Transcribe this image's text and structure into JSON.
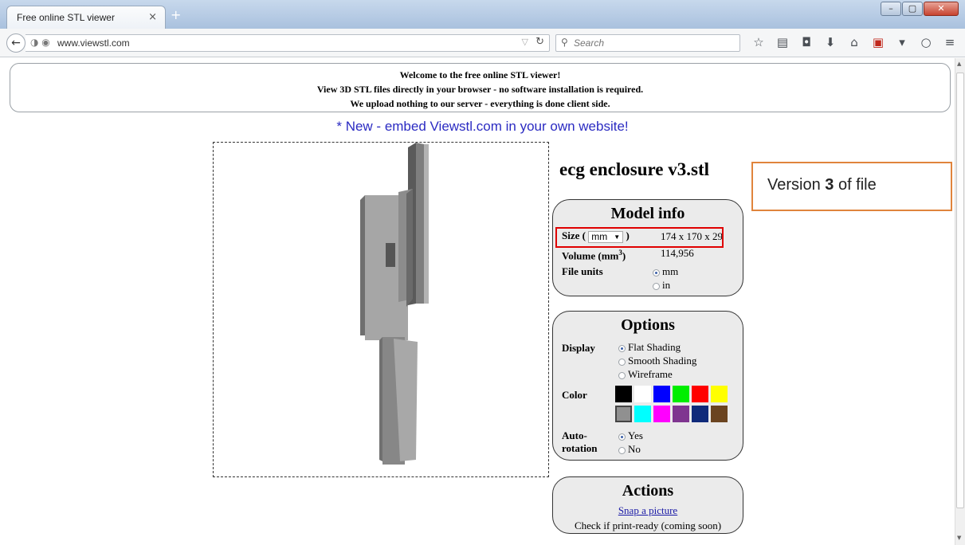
{
  "browser": {
    "tab_title": "Free online STL viewer",
    "tab_close": "×",
    "new_tab": "+",
    "url": "www.viewstl.com",
    "search_placeholder": "Search",
    "window_controls": [
      "–",
      "▢",
      "✕"
    ]
  },
  "welcome": {
    "line1": "Welcome to the free online STL viewer!",
    "line2": "View 3D STL files directly in your browser - no software installation is required.",
    "line3": "We upload nothing to our server - everything is done client side."
  },
  "embed_link": "* New - embed Viewstl.com in your own website!",
  "file_name": "ecg enclosure v3.stl",
  "model_info": {
    "title": "Model info",
    "size_label": "Size (",
    "size_label_end": ")",
    "size_unit": "mm",
    "size_value": "174 x 170 x 29",
    "volume_label": "Volume (mm",
    "volume_sup": "3",
    "volume_label_end": ")",
    "volume_value": "114,956",
    "file_units_label": "File units",
    "file_units": [
      {
        "label": "mm",
        "selected": true
      },
      {
        "label": "in",
        "selected": false
      }
    ]
  },
  "options": {
    "title": "Options",
    "display_label": "Display",
    "display_options": [
      {
        "label": "Flat Shading",
        "selected": true
      },
      {
        "label": "Smooth Shading",
        "selected": false
      },
      {
        "label": "Wireframe",
        "selected": false
      }
    ],
    "color_label": "Color",
    "colors": [
      "#000000",
      "#ffffff",
      "#0000ff",
      "#00ee00",
      "#ff0000",
      "#ffff00",
      "#909090",
      "#00ffff",
      "#ff00ff",
      "#7f3590",
      "#0f2a7a",
      "#6b4420"
    ],
    "selected_color": "#909090",
    "autorotation_label_1": "Auto-",
    "autorotation_label_2": "rotation",
    "autorotation_options": [
      {
        "label": "Yes",
        "selected": true
      },
      {
        "label": "No",
        "selected": false
      }
    ]
  },
  "actions": {
    "title": "Actions",
    "snap_link": "Snap a picture",
    "print_ready": "Check if print-ready (coming soon)"
  },
  "callout": {
    "text_before": "Version ",
    "text_number": "3",
    "text_after": " of file",
    "border_color": "#e0843c"
  },
  "highlight_color": "#e00000"
}
